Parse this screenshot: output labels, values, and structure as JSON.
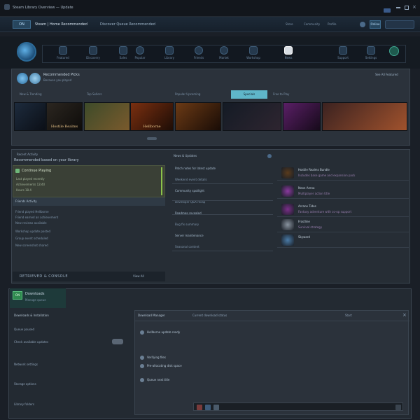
{
  "topbar": {
    "title": "Steam Library Overview — Update",
    "account_label": "Steam",
    "window_controls": [
      "minimize-icon",
      "maximize-icon",
      "close-icon"
    ]
  },
  "subbar": {
    "badge": "ON",
    "url": "Steam | Home Recommended",
    "section": "Discover Queue Recommended",
    "right_links": [
      "Store",
      "Community",
      "Profile"
    ],
    "user_label": "Online"
  },
  "nav": {
    "items": [
      "Featured",
      "Discovery",
      "Sales",
      "Popular",
      "Library",
      "Friends",
      "Market",
      "Workshop",
      "News",
      "Support",
      "Settings"
    ]
  },
  "featured": {
    "title": "Recommended Picks",
    "subtitle": "Because you played",
    "tabs": [
      "New & Trending",
      "Top Sellers",
      "Popular Upcoming",
      "Specials",
      "Free to Play"
    ],
    "active_tab_index": 3,
    "right_label": "See All Featured",
    "tiles": [
      {
        "label": "",
        "color_a": "#1d2b3d",
        "color_b": "#0b0f16"
      },
      {
        "label": "Hostile Realms",
        "color_a": "#2b2620",
        "color_b": "#0e0c0a"
      },
      {
        "label": "",
        "color_a": "#3d4b2a",
        "color_b": "#7a5a2c"
      },
      {
        "label": "Hellborne",
        "color_a": "#7a2f10",
        "color_b": "#1d0d06"
      },
      {
        "label": "",
        "color_a": "#6b3a15",
        "color_b": "#190c06"
      },
      {
        "label": "",
        "color_a": "#141b25",
        "color_b": "#2e2530"
      },
      {
        "label": "",
        "color_a": "#5a1f66",
        "color_b": "#160a1a"
      },
      {
        "label": "",
        "color_a": "#3b2220",
        "color_b": "#a0522d"
      }
    ]
  },
  "activity": {
    "header": "Recent Activity",
    "subheader": "Recommended based on your library",
    "highlight_title": "Continue Playing",
    "highlight_lines": [
      "Last played recently",
      "Achievements 12/40",
      "Hours 18.4"
    ],
    "list_title": "Friends Activity",
    "list_items": [
      "Friend played Hellborne",
      "Friend earned an achievement",
      "New reviews available"
    ],
    "more_items": [
      "Workshop update posted",
      "Group event scheduled",
      "New screenshot shared"
    ],
    "footer_title": "RETRIEVED & CONSOLE",
    "footer_right": "View All"
  },
  "news": {
    "header": "News & Updates",
    "items": [
      "Patch notes for latest update",
      "Weekend event details",
      "Community spotlight",
      "Developer Q&A recap",
      "Roadmap revealed",
      "Bug fix summary",
      "Server maintenance",
      "Seasonal content"
    ]
  },
  "store_list": {
    "items": [
      {
        "title": "Hostile Realms Bundle",
        "sub": "Includes base game and expansion pack",
        "color": "#5a3b1c"
      },
      {
        "title": "Neon Arena",
        "sub": "Multiplayer action title",
        "color": "#8b3aa0"
      },
      {
        "title": "Arcane Tides",
        "sub": "Fantasy adventure with co-op support",
        "color": "#7b2f8a"
      },
      {
        "title": "Frostline",
        "sub": "Survival strategy",
        "color": "#8a94a0"
      },
      {
        "title": "Skyward",
        "sub": "",
        "color": "#4a7ba7"
      }
    ]
  },
  "bottom": {
    "badge": "ON",
    "title": "Downloads",
    "subtitle": "Manage queue",
    "left_items": [
      "Downloads & Installation",
      "Queue paused",
      "Check available updates",
      "Network settings",
      "Storage options",
      "Library folders"
    ],
    "center_header": "Download Manager",
    "center_sub": "Current download status",
    "center_items": [
      "Hellborne update ready",
      "Verifying files",
      "Pre-allocating disk space",
      "Queue next title"
    ],
    "right_label": "Start",
    "close_label": "×"
  }
}
